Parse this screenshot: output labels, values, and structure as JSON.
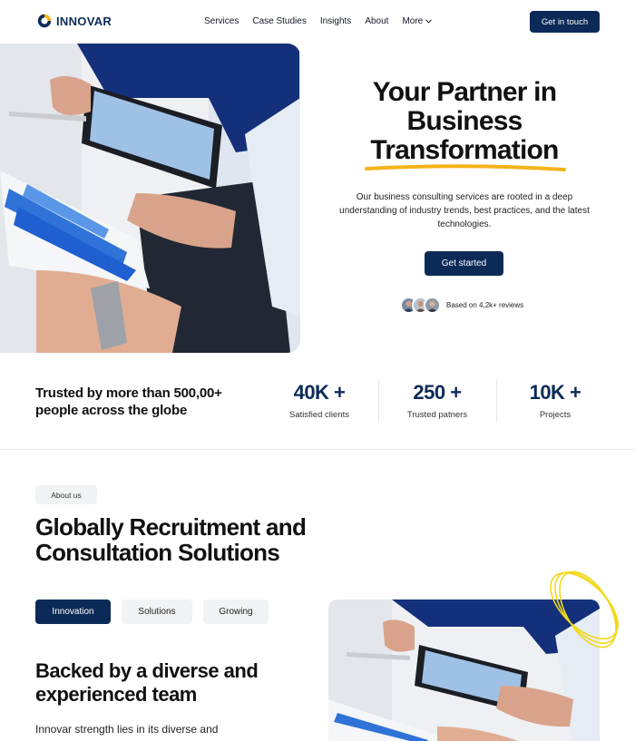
{
  "brand": {
    "name": "INNOVAR",
    "accent": "#0b2a57",
    "highlight": "#f5b21a"
  },
  "nav": {
    "items": [
      "Services",
      "Case Studies",
      "Insights",
      "About",
      "More"
    ],
    "cta": "Get in touch"
  },
  "hero": {
    "title_line1": "Your Partner in",
    "title_line2": "Business",
    "title_line3": "Transformation",
    "description": "Our business consulting services are rooted in a deep understanding of industry trends, best practices, and the latest technologies.",
    "button": "Get started",
    "reviews": "Based on 4,2k+ reviews"
  },
  "stats": {
    "headline": "Trusted by more than 500,00+ people across the globe",
    "items": [
      {
        "value": "40K +",
        "label": "Satisfied clients"
      },
      {
        "value": "250 +",
        "label": "Trusted patners"
      },
      {
        "value": "10K +",
        "label": "Projects"
      }
    ]
  },
  "about": {
    "pill": "About us",
    "title": "Globally Recruitment and Consultation Solutions",
    "tabs": [
      "Innovation",
      "Solutions",
      "Growing"
    ],
    "active_tab": "Innovation",
    "team_title": "Backed by a diverse and experienced team",
    "team_desc": "Innovar strength lies in its diverse and"
  }
}
